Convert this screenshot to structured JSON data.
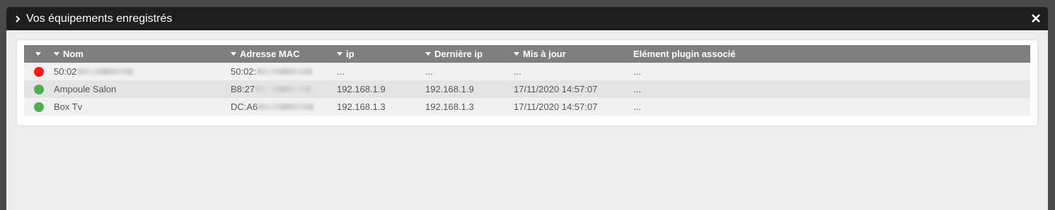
{
  "window": {
    "title": "Vos équipements enregistrés",
    "icons": {
      "chevron": "chevron-right-icon",
      "close": "close-icon"
    }
  },
  "table": {
    "columns": [
      "",
      "Nom",
      "Adresse MAC",
      "ip",
      "Dernière ip",
      "Mis à jour",
      "Elément plugin associé"
    ],
    "rows": [
      {
        "status_color": "#ff1a1a",
        "name": "50:02",
        "mac": "50:02:",
        "ip": "...",
        "last_ip": "...",
        "updated": "...",
        "plugin": "..."
      },
      {
        "status_color": "#4caf50",
        "name": "Ampoule Salon",
        "mac": "B8:27",
        "ip": "192.168.1.9",
        "last_ip": "192.168.1.9",
        "updated": "17/11/2020 14:57:07",
        "plugin": "..."
      },
      {
        "status_color": "#4caf50",
        "name": "Box Tv",
        "mac": "DC:A6",
        "ip": "192.168.1.3",
        "last_ip": "192.168.1.3",
        "updated": "17/11/2020 14:57:07",
        "plugin": "..."
      }
    ]
  },
  "colors": {
    "header_bg": "#1e1e1e",
    "table_header_bg": "#7f7f7f",
    "status_red": "#ff1a1a",
    "status_green": "#4caf50"
  }
}
